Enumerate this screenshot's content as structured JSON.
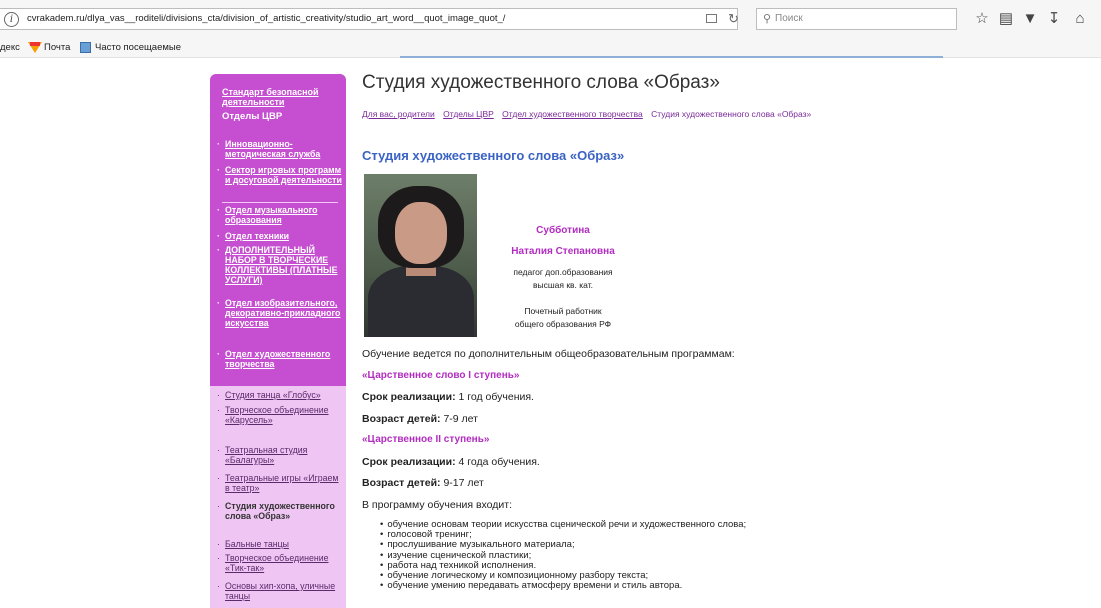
{
  "browser": {
    "url": "cvrakadem.ru/dlya_vas__roditeli/divisions_cta/division_of_artistic_creativity/studio_art_word__quot_image_quot_/",
    "search_placeholder": "Поиск",
    "bookmarks": [
      "декс",
      "Почта",
      "Часто посещаемые"
    ]
  },
  "sidebar": {
    "top_link": "Стандарт безопасной деятельности",
    "heading": "Отделы ЦВР",
    "items": [
      "Инновационно-методическая служба",
      "Сектор игровых программ и досуговой деятельности",
      "Отдел музыкального образования",
      "Отдел техники",
      "ДОПОЛНИТЕЛЬНЫЙ НАБОР В ТВОРЧЕСКИЕ КОЛЛЕКТИВЫ (ПЛАТНЫЕ УСЛУГИ)",
      "Отдел изобразительного, декоративно-прикладного искусства",
      "Отдел художественного творчества"
    ],
    "subitems": [
      "Студия танца «Глобус»",
      "Творческое объединение «Карусель»",
      "Театральная студия «Балагуры»",
      "Театральные игры «Играем в театр»",
      "Студия художественного слова «Образ»",
      "Бальные танцы",
      "Творческое объединение «Тик-так»",
      "Основы хип-хопа, уличные танцы"
    ]
  },
  "main": {
    "title": "Студия художественного слова «Образ»",
    "breadcrumb": [
      "Для вас, родители",
      "Отделы ЦВР",
      "Отдел художественного творчества",
      "Студия художественного слова «Образ»"
    ],
    "section_title": "Студия художественного слова «Образ»",
    "teacher": {
      "surname": "Субботина",
      "name": "Наталия Степановна",
      "position_line1": "педагог доп.образования",
      "position_line2": "высшая кв. кат.",
      "honor_line1": "Почетный работник",
      "honor_line2": "общего образования РФ"
    },
    "intro": "Обучение ведется по дополнительным общеобразовательным программам:",
    "program1": {
      "title": "«Царственное слово  I ступень»",
      "term_label": "Срок реализации:",
      "term": " 1 год обучения.",
      "age_label": "Возраст  детей:",
      "age": " 7-9 лет"
    },
    "program2": {
      "title": "«Царственное II ступень»",
      "term_label": "Срок реализации:",
      "term": " 4 года обучения.",
      "age_label": "Возраст  детей:",
      "age": " 9-17 лет"
    },
    "includes_intro": "В программу обучения входит:",
    "includes": [
      "обучение основам теории искусства сценической речи и художественного слова;",
      "голосовой тренинг;",
      "прослушивание музыкального материала;",
      "изучение сценической пластики;",
      "работа над техникой исполнения.",
      "обучение логическому и композиционному разбору текста;",
      "обучение умению передавать атмосферу времени и стиль автора."
    ]
  }
}
